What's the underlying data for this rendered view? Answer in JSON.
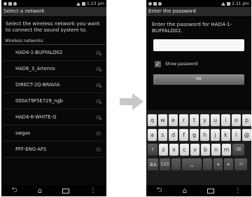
{
  "left_screen": {
    "status": {
      "time": "1:23 pm"
    },
    "title": "Select a network",
    "instruction": "Select the wireless network you want to connect the sound system to.",
    "section_header": "Wireless networks",
    "networks": [
      {
        "name": "HAD4-1-BUFFALO02"
      },
      {
        "name": "HAD6_3_Artemis"
      },
      {
        "name": "DIRECT-2Q-BRAVIA"
      },
      {
        "name": "000A79F5E729_ngb"
      },
      {
        "name": "HAD4-6-WHITE-G"
      },
      {
        "name": "swgas"
      },
      {
        "name": "PFF-ENG-AFS"
      }
    ],
    "nav": {
      "back": "⮌",
      "home": "⌂",
      "menu": "⋮"
    }
  },
  "right_screen": {
    "status": {
      "time": "2:31 pm"
    },
    "title": "Enter the password",
    "instruction": "Enter the password for HAD4-1-BUFFALO02.",
    "password_value": "",
    "show_password_label": "Show password",
    "show_password_checked": true,
    "ok_label": "OK",
    "keyboard": {
      "row1": [
        "q",
        "w",
        "e",
        "r",
        "t",
        "y",
        "u",
        "i",
        "o",
        "p"
      ],
      "row2": [
        "a",
        "s",
        "d",
        "f",
        "g",
        "h",
        "j",
        "k",
        "l",
        "@"
      ],
      "row3": [
        "⇧",
        "z",
        "x",
        "c",
        "v",
        "b",
        "n",
        "m",
        "⌫"
      ],
      "row4": [
        "あA",
        "123",
        ",",
        "␣",
        ".",
        "◂",
        "▸",
        "⏎"
      ]
    },
    "nav": {
      "back": "⮌",
      "home": "⌂",
      "menu": "⋮"
    }
  },
  "colors": {
    "screen_bg": "#080808",
    "arrow": "#c8c8c8",
    "title_bar": "#2a2a2a"
  }
}
